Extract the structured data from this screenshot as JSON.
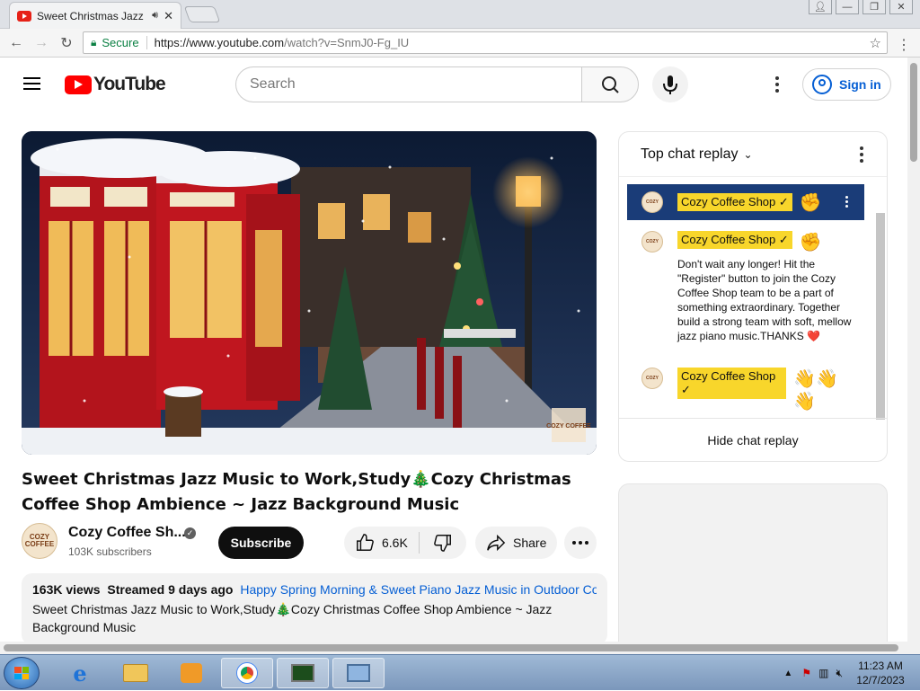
{
  "browser": {
    "tab_title": "Sweet Christmas Jazz",
    "secure_label": "Secure",
    "url_host": "https://www.youtube.com",
    "url_path": "/watch?v=SnmJ0-Fg_IU"
  },
  "header": {
    "logo_text": "YouTube",
    "search_placeholder": "Search",
    "signin_label": "Sign in"
  },
  "video": {
    "title": "Sweet Christmas Jazz Music to Work,Study🎄Cozy Christmas Coffee Shop Ambience ~ Jazz Background Music",
    "channel_name": "Cozy Coffee Sh...",
    "subscribers": "103K subscribers",
    "subscribe_label": "Subscribe",
    "likes": "6.6K",
    "share_label": "Share",
    "watermark_text": "COZY COFFEE"
  },
  "description": {
    "views": "163K views",
    "streamed": "Streamed 9 days ago",
    "related": "Happy Spring Morning & Sweet Piano Jazz Music in Outdoor Coffee",
    "text": "Sweet Christmas Jazz Music to Work,Study🎄Cozy Christmas Coffee Shop Ambience ~ Jazz Background Music"
  },
  "chat": {
    "header": "Top chat replay",
    "pinned": {
      "author": "Cozy Coffee Shop ✓",
      "emoji": "✊"
    },
    "messages": [
      {
        "author": "Cozy Coffee Shop ✓",
        "emoji": "✊",
        "text": "Don't wait any longer! Hit the \"Register\" button to join the Cozy Coffee Shop team to be a part of something extraordinary. Together build a strong team with soft, mellow jazz piano music.THANKS ❤️"
      },
      {
        "author": "Cozy Coffee Shop ✓",
        "emoji": "👋👋👋",
        "text": ""
      }
    ],
    "hide_label": "Hide chat replay"
  },
  "taskbar": {
    "time": "11:23 AM",
    "date": "12/7/2023"
  },
  "colors": {
    "youtube_red": "#ff0000",
    "link_blue": "#065fd4",
    "badge_yellow": "#f8d62b"
  }
}
